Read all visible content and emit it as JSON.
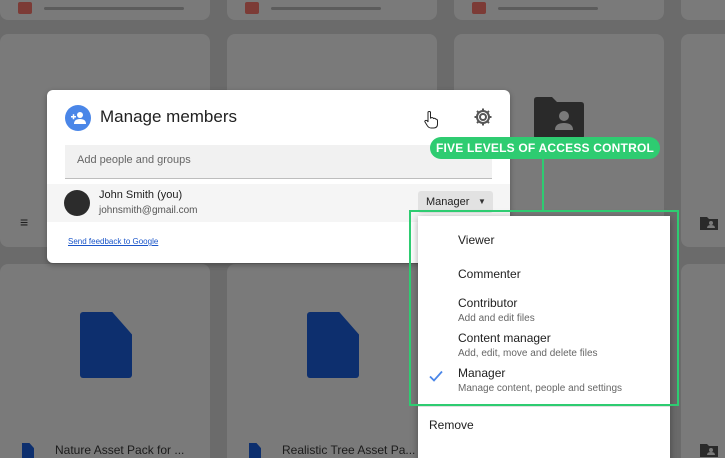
{
  "dialog": {
    "title": "Manage members",
    "add_placeholder": "Add people and groups",
    "member": {
      "name": "John Smith (you)",
      "email": "johnsmith@gmail.com",
      "role": "Manager"
    },
    "feedback_link": "Send feedback to Google"
  },
  "roles_menu": {
    "options": [
      {
        "label": "Viewer",
        "description": "",
        "selected": false
      },
      {
        "label": "Commenter",
        "description": "",
        "selected": false
      },
      {
        "label": "Contributor",
        "description": "Add and edit files",
        "selected": false
      },
      {
        "label": "Content manager",
        "description": "Add, edit, move and delete files",
        "selected": false
      },
      {
        "label": "Manager",
        "description": "Manage content, people and settings",
        "selected": true
      }
    ],
    "remove_label": "Remove"
  },
  "annotation": {
    "text": "FIVE LEVELS OF ACCESS CONTROL",
    "color": "#2ecc71"
  },
  "background_files": [
    {
      "name": "Nature Asset Pack for ..."
    },
    {
      "name": "Realistic Tree Asset Pa..."
    }
  ],
  "colors": {
    "accent": "#4a86e8",
    "doc_icon": "#0d2f6e",
    "link": "#1a55c9",
    "overlay": "#6b6b6b"
  }
}
